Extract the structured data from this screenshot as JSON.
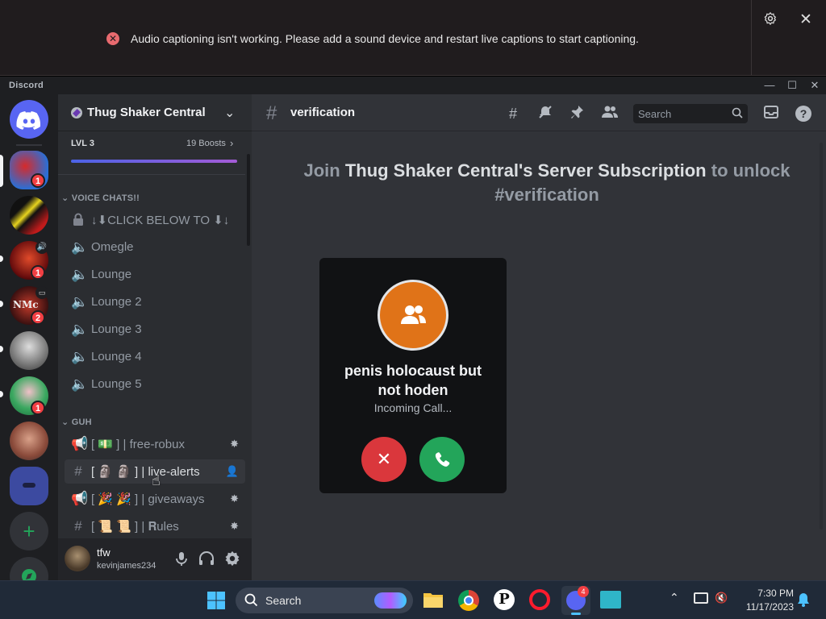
{
  "caption_banner": {
    "message": "Audio captioning isn't working. Please add a sound device and restart live captions to start captioning."
  },
  "window": {
    "app_name": "Discord"
  },
  "servers": [
    {
      "name": "server-1",
      "badge": "1",
      "active": true
    },
    {
      "name": "server-2",
      "badge": ""
    },
    {
      "name": "server-3",
      "badge": "1",
      "speaker": true
    },
    {
      "name": "server-4",
      "badge": "2",
      "screen": true
    },
    {
      "name": "server-5",
      "badge": ""
    },
    {
      "name": "server-6",
      "badge": "1"
    },
    {
      "name": "server-7",
      "badge": ""
    },
    {
      "name": "server-8",
      "badge": ""
    }
  ],
  "sidebar": {
    "server_name": "Thug Shaker Central",
    "boost": {
      "level": "LVL 3",
      "count": "19 Boosts"
    },
    "categories": [
      {
        "label": "VOICE CHATS!!"
      },
      {
        "label": "GUH"
      }
    ],
    "voice_channels": [
      {
        "label": "↓⬇CLICK BELOW TO ⬇↓",
        "locked": true
      },
      {
        "label": "Omegle"
      },
      {
        "label": "Lounge"
      },
      {
        "label": "Lounge 2"
      },
      {
        "label": "Lounge 3"
      },
      {
        "label": "Lounge 4"
      },
      {
        "label": "Lounge 5"
      }
    ],
    "text_channels": [
      {
        "prefix": "[ 💵 ]",
        "label": "| free-robux"
      },
      {
        "prefix": "[ 🗿 🗿 ]",
        "label": "| live-alerts"
      },
      {
        "prefix": "[ 🎉 🎉 ]",
        "label": "| giveaways"
      },
      {
        "prefix": "[ 📜 📜 ]",
        "label": "| 𝐑ules"
      }
    ]
  },
  "user": {
    "display_name": "tfw",
    "username": "kevinjames234"
  },
  "main": {
    "channel_name": "verification",
    "search_placeholder": "Search",
    "join_prefix": "Join",
    "join_server": "Thug Shaker Central's Server Subscription",
    "join_suffix": "to unlock",
    "join_channel": "#verification"
  },
  "call": {
    "caller": "penis holocaust but not hoden",
    "status": "Incoming Call..."
  },
  "taskbar": {
    "search_label": "Search",
    "discord_badge": "4",
    "time": "7:30 PM",
    "date": "11/17/2023"
  },
  "colors": {
    "accent": "#5865f2",
    "decline": "#da373c",
    "accept": "#23a55a",
    "avatar": "#e07318"
  }
}
